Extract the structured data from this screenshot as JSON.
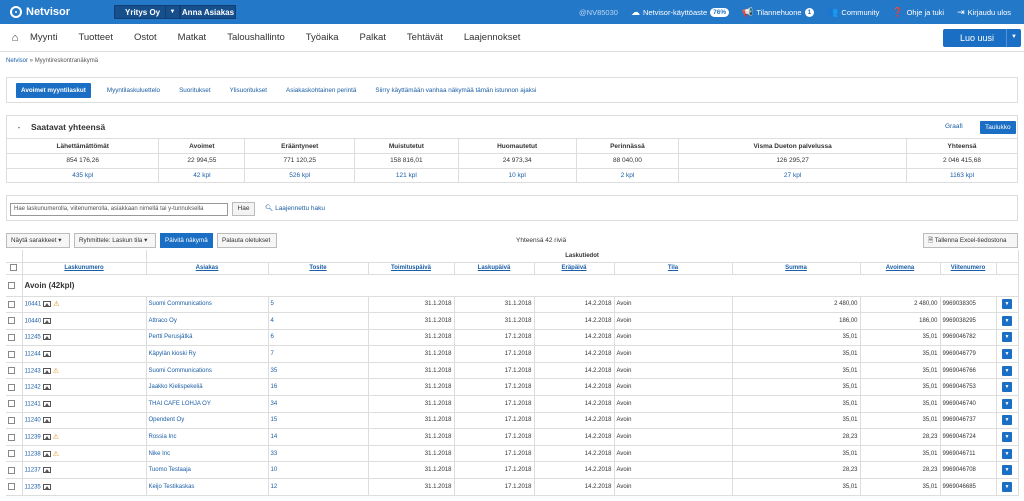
{
  "header": {
    "logo": "Netvisor",
    "company": "Yritys Oy",
    "user": "Anna Asiakas",
    "nvid": "@NV85030",
    "usage_label": "Netvisor-käyttöaste",
    "usage_value": "76%",
    "status_label": "Tilannehuone",
    "status_count": "1",
    "community": "Community",
    "help": "Ohje ja tuki",
    "logout": "Kirjaudu ulos"
  },
  "menu": {
    "items": [
      "Myynti",
      "Tuotteet",
      "Ostot",
      "Matkat",
      "Taloushallinto",
      "Työaika",
      "Palkat",
      "Tehtävät",
      "Laajennokset"
    ],
    "new_button": "Luo uusi"
  },
  "breadcrumb": {
    "root": "Netvisor",
    "sep": " » ",
    "current": "Myyntireskontranäkymä"
  },
  "tabs": [
    "Avoimet myyntilaskut",
    "Myyntilaskuluettelo",
    "Suoritukset",
    "Ylisuoritukset",
    "Asiakaskohtainen perintä",
    "Siirry käyttämään vanhaa näkymää tämän istunnon ajaksi"
  ],
  "summary": {
    "title": "Saatavat yhteensä",
    "view_graph": "Graafi",
    "view_table": "Taulukko",
    "columns": [
      "Lähettämättömät",
      "Avoimet",
      "Erääntyneet",
      "Muistutetut",
      "Huomautetut",
      "Perinnässä",
      "Visma Dueton palvelussa",
      "Yhteensä"
    ],
    "amounts": [
      "854 176,26",
      "22 994,55",
      "771 120,25",
      "158 816,01",
      "24 973,34",
      "88 040,00",
      "126 295,27",
      "2 046 415,68"
    ],
    "counts": [
      "435 kpl",
      "42 kpl",
      "526 kpl",
      "121 kpl",
      "10 kpl",
      "2 kpl",
      "27 kpl",
      "1163 kpl"
    ]
  },
  "search": {
    "placeholder": "Hae laskunumerolla, viitenumerolla, asiakkaan nimellä tai y-tunnuksella",
    "button": "Hae",
    "advanced": "Laajennettu haku"
  },
  "toolbar": {
    "show_columns": "Näytä sarakkeet",
    "group_by": "Ryhmittele: Laskun tila",
    "refresh": "Päivitä näkymä",
    "reset": "Palauta oletukset",
    "total": "Yhteensä 42 riviä",
    "excel": "Tallenna Excel-tiedostona"
  },
  "grid": {
    "group_header": "Laskutiedot",
    "columns": [
      "Laskunumero",
      "Asiakas",
      "Tosite",
      "Toimituspäivä",
      "Laskupäivä",
      "Eräpäivä",
      "Tila",
      "Summa",
      "Avoimena",
      "Viitenumero"
    ],
    "group_label": "Avoin (42kpl)",
    "rows": [
      {
        "no": "10441",
        "warn": true,
        "customer": "Suomi Communications",
        "voucher": "5",
        "delivery": "31.1.2018",
        "invoice": "31.1.2018",
        "due": "14.2.2018",
        "status": "Avoin",
        "sum": "2 480,00",
        "open": "2 480,00",
        "ref": "9969038305"
      },
      {
        "no": "10440",
        "warn": false,
        "customer": "Attraco Oy",
        "voucher": "4",
        "delivery": "31.1.2018",
        "invoice": "31.1.2018",
        "due": "14.2.2018",
        "status": "Avoin",
        "sum": "186,00",
        "open": "186,00",
        "ref": "9969038295"
      },
      {
        "no": "11245",
        "warn": false,
        "customer": "Pertti Perusjätkä",
        "voucher": "6",
        "delivery": "31.1.2018",
        "invoice": "17.1.2018",
        "due": "14.2.2018",
        "status": "Avoin",
        "sum": "35,01",
        "open": "35,01",
        "ref": "9969046782"
      },
      {
        "no": "11244",
        "warn": false,
        "customer": "Käpylän kioski Ry",
        "voucher": "7",
        "delivery": "31.1.2018",
        "invoice": "17.1.2018",
        "due": "14.2.2018",
        "status": "Avoin",
        "sum": "35,01",
        "open": "35,01",
        "ref": "9969046779"
      },
      {
        "no": "11243",
        "warn": true,
        "customer": "Suomi Communications",
        "voucher": "35",
        "delivery": "31.1.2018",
        "invoice": "17.1.2018",
        "due": "14.2.2018",
        "status": "Avoin",
        "sum": "35,01",
        "open": "35,01",
        "ref": "9969046766"
      },
      {
        "no": "11242",
        "warn": false,
        "customer": "Jaakko Kielispekeliä",
        "voucher": "16",
        "delivery": "31.1.2018",
        "invoice": "17.1.2018",
        "due": "14.2.2018",
        "status": "Avoin",
        "sum": "35,01",
        "open": "35,01",
        "ref": "9969046753"
      },
      {
        "no": "11241",
        "warn": false,
        "customer": "THAI CAFE LOHJA OY",
        "voucher": "34",
        "delivery": "31.1.2018",
        "invoice": "17.1.2018",
        "due": "14.2.2018",
        "status": "Avoin",
        "sum": "35,01",
        "open": "35,01",
        "ref": "9969046740"
      },
      {
        "no": "11240",
        "warn": false,
        "customer": "Opendent Oy",
        "voucher": "15",
        "delivery": "31.1.2018",
        "invoice": "17.1.2018",
        "due": "14.2.2018",
        "status": "Avoin",
        "sum": "35,01",
        "open": "35,01",
        "ref": "9969046737"
      },
      {
        "no": "11239",
        "warn": true,
        "customer": "Rossia Inc",
        "voucher": "14",
        "delivery": "31.1.2018",
        "invoice": "17.1.2018",
        "due": "14.2.2018",
        "status": "Avoin",
        "sum": "28,23",
        "open": "28,23",
        "ref": "9969046724"
      },
      {
        "no": "11238",
        "warn": true,
        "customer": "Nike Inc",
        "voucher": "33",
        "delivery": "31.1.2018",
        "invoice": "17.1.2018",
        "due": "14.2.2018",
        "status": "Avoin",
        "sum": "35,01",
        "open": "35,01",
        "ref": "9969046711"
      },
      {
        "no": "11237",
        "warn": false,
        "customer": "Tuomo Testaaja",
        "voucher": "10",
        "delivery": "31.1.2018",
        "invoice": "17.1.2018",
        "due": "14.2.2018",
        "status": "Avoin",
        "sum": "28,23",
        "open": "28,23",
        "ref": "9969046708"
      },
      {
        "no": "11235",
        "warn": false,
        "customer": "Keijo Testikaskas",
        "voucher": "12",
        "delivery": "31.1.2018",
        "invoice": "17.1.2018",
        "due": "14.2.2018",
        "status": "Avoin",
        "sum": "35,01",
        "open": "35,01",
        "ref": "9969046685"
      }
    ]
  }
}
